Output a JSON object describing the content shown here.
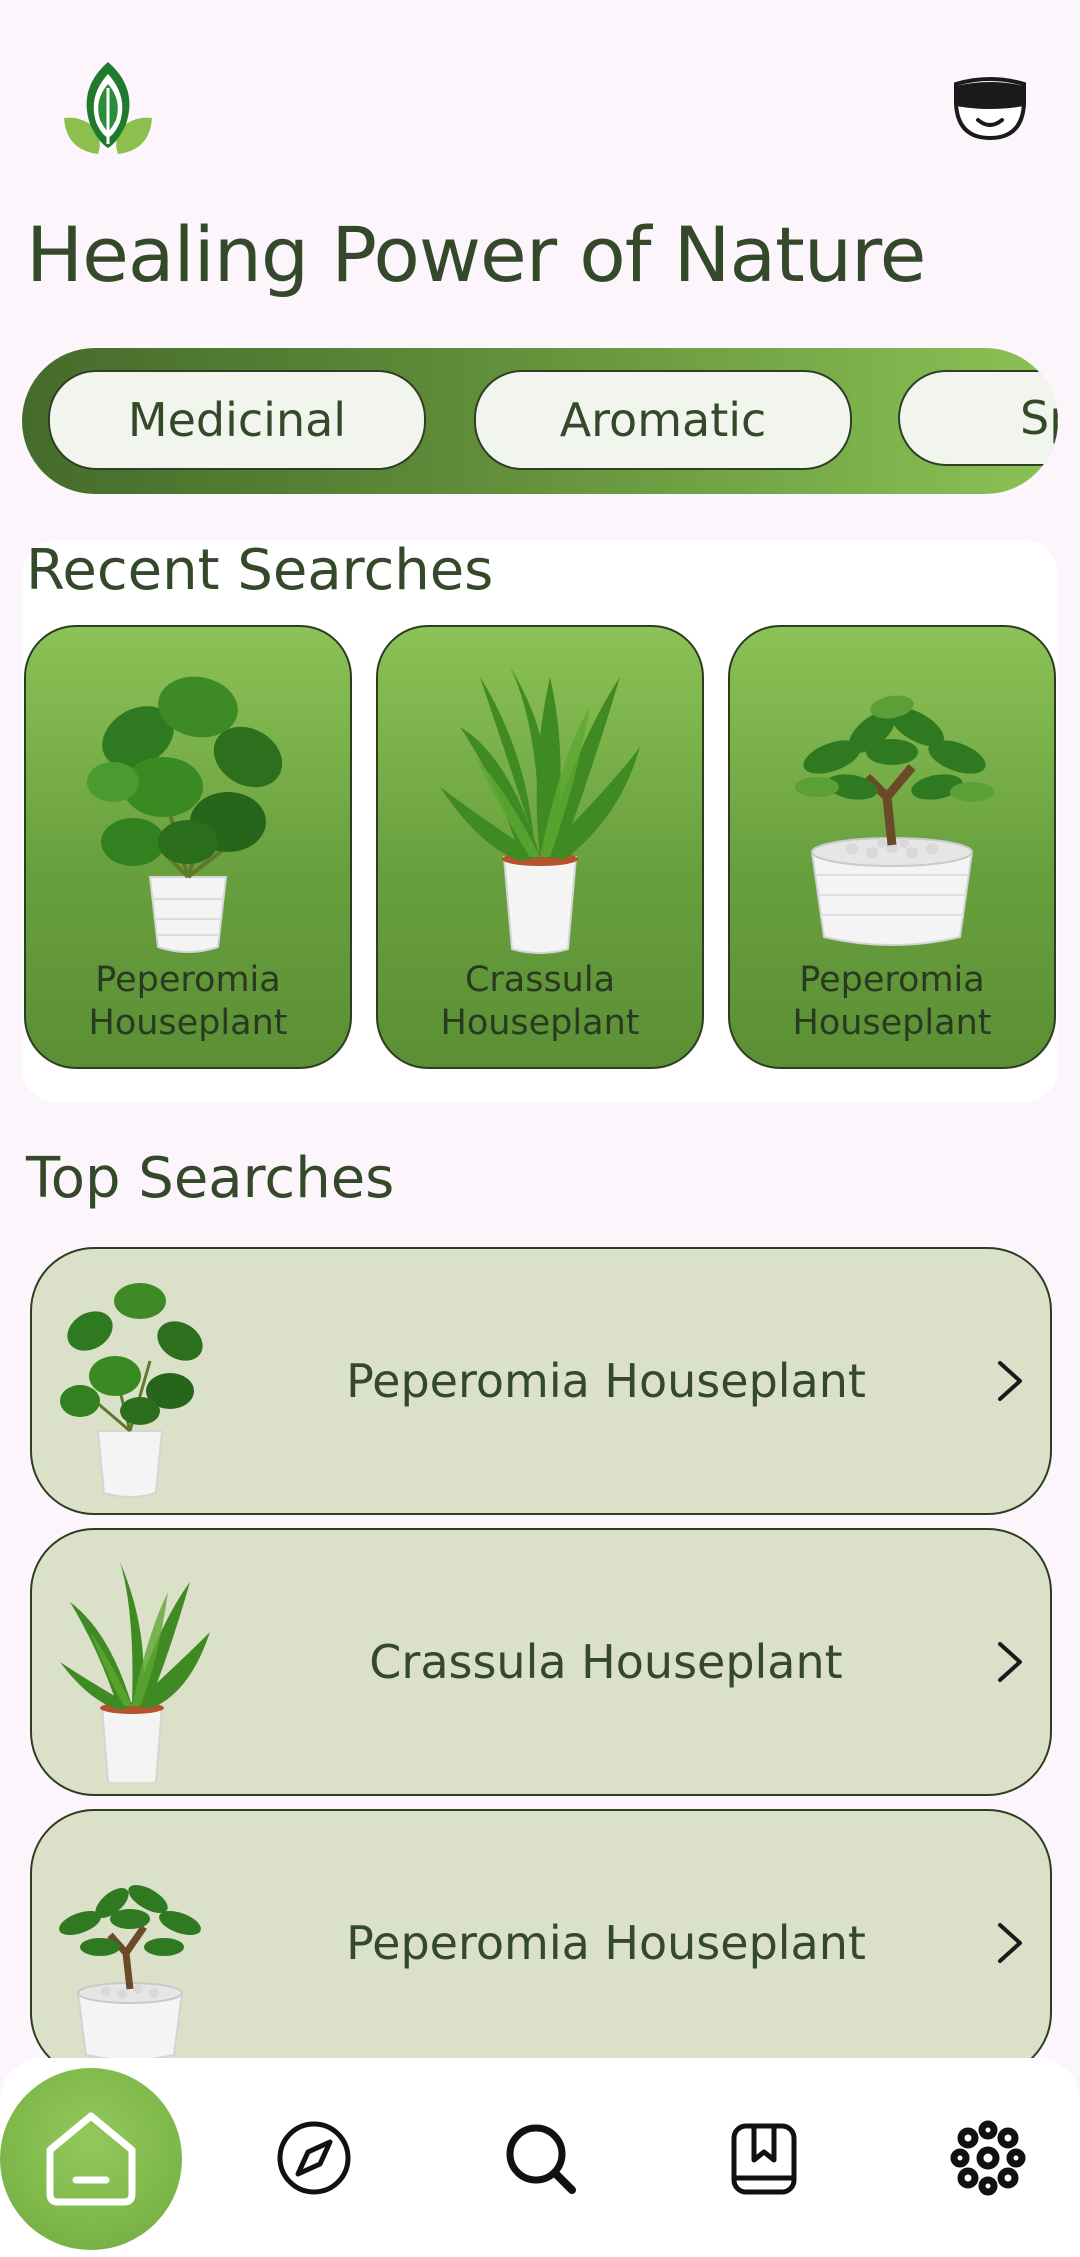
{
  "header": {
    "logo_icon": "leaf-logo-icon",
    "profile_icon": "vr-headset-avatar-icon",
    "title": "Healing Power of Nature"
  },
  "categories": [
    {
      "label": "Medicinal"
    },
    {
      "label": "Aromatic"
    },
    {
      "label": "Sp"
    }
  ],
  "recent": {
    "title": "Recent Searches",
    "items": [
      {
        "line1": "Peperomia",
        "line2": "Houseplant",
        "plant": "pilea-plant"
      },
      {
        "line1": "Crassula",
        "line2": "Houseplant",
        "plant": "fern-plant"
      },
      {
        "line1": "Peperomia",
        "line2": "Houseplant",
        "plant": "jade-plant"
      }
    ]
  },
  "top": {
    "title": "Top Searches",
    "items": [
      {
        "label": "Peperomia Houseplant",
        "plant": "pilea-plant"
      },
      {
        "label": "Crassula Houseplant",
        "plant": "fern-plant"
      },
      {
        "label": "Peperomia Houseplant",
        "plant": "jade-plant"
      }
    ]
  },
  "nav": {
    "items": [
      "home-icon",
      "compass-icon",
      "search-icon",
      "bookmark-icon",
      "plant-cell-icon"
    ],
    "active": "home-icon"
  },
  "colors": {
    "background": "#fcf5fb",
    "accent_green": "#7eb84a",
    "dark_text": "#34492a",
    "row_bg": "#dae1c8"
  }
}
